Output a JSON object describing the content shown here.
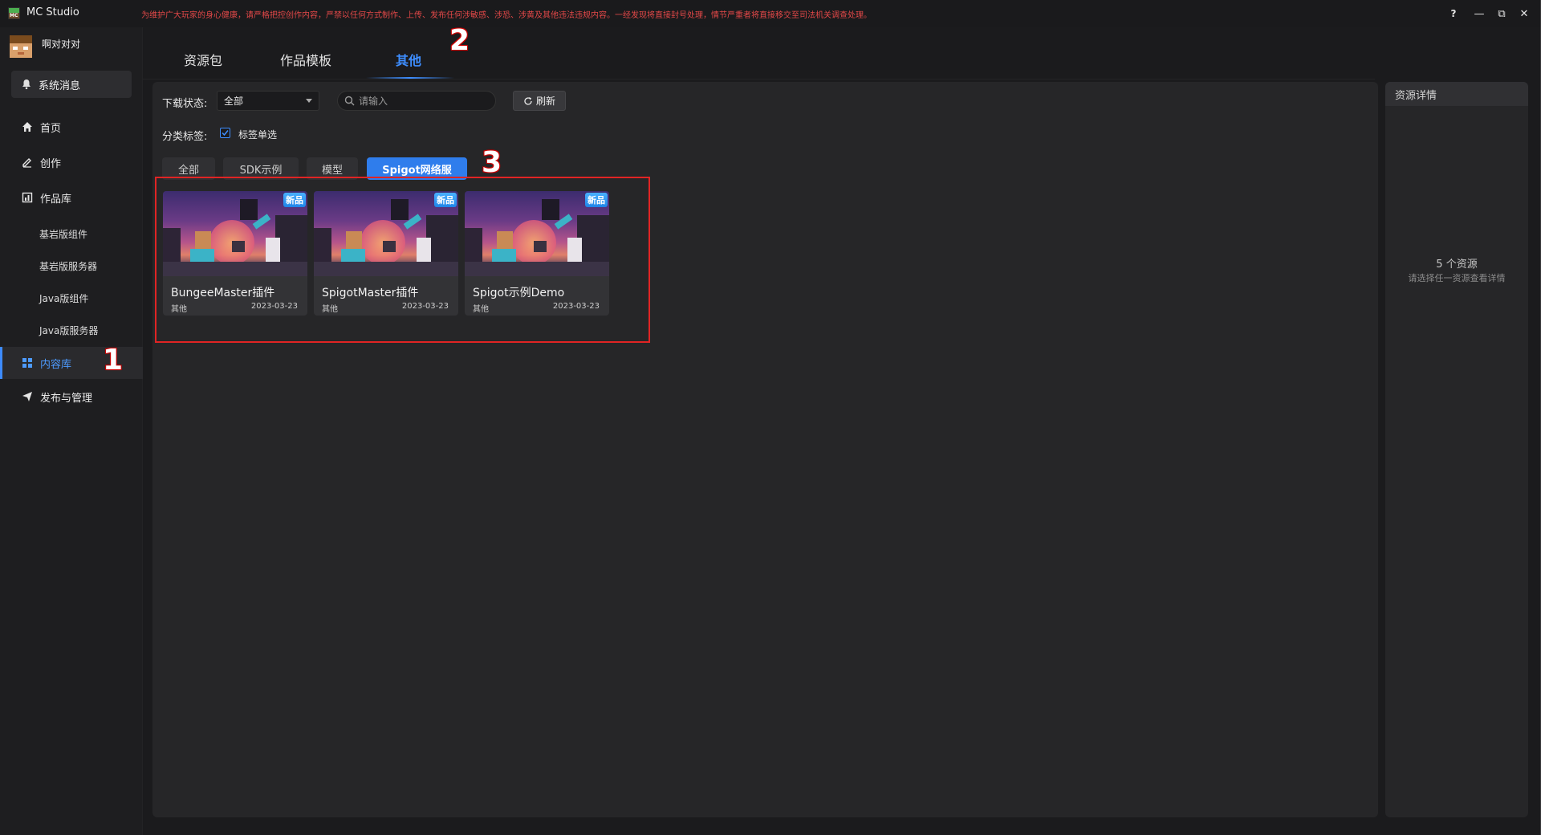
{
  "app": {
    "title": "MC Studio",
    "notice": "为维护广大玩家的身心健康，请严格把控创作内容，严禁以任何方式制作、上传、发布任何涉敏感、涉恐、涉黄及其他违法违规内容。一经发现将直接封号处理，情节严重者将直接移交至司法机关调查处理。",
    "window_controls": {
      "help": "?",
      "minimize": "—",
      "restore": "⧉",
      "close": "✕"
    }
  },
  "user": {
    "name": "啊对对对"
  },
  "sidebar": {
    "system_message": "系统消息",
    "items": [
      {
        "label": "首页",
        "icon": "home-icon"
      },
      {
        "label": "创作",
        "icon": "edit-icon"
      },
      {
        "label": "作品库",
        "icon": "library-icon"
      }
    ],
    "sub_items": [
      "基岩版组件",
      "基岩版服务器",
      "Java版组件",
      "Java版服务器"
    ],
    "active_item": {
      "label": "内容库",
      "icon": "grid-icon"
    },
    "publish_item": {
      "label": "发布与管理",
      "icon": "send-icon"
    }
  },
  "tabs": [
    "资源包",
    "作品模板",
    "其他"
  ],
  "active_tab": "其他",
  "filters": {
    "download_status_label": "下载状态:",
    "download_status_value": "全部",
    "search_placeholder": "请输入",
    "refresh_label": "刷新",
    "category_label": "分类标签:",
    "single_select_label": "标签单选",
    "single_select_checked": true
  },
  "categories": [
    "全部",
    "SDK示例",
    "模型",
    "Spigot网络服"
  ],
  "active_category": "Spigot网络服",
  "cards": [
    {
      "title": "BungeeMaster插件",
      "category": "其他",
      "date": "2023-03-23",
      "badge": "新品"
    },
    {
      "title": "SpigotMaster插件",
      "category": "其他",
      "date": "2023-03-23",
      "badge": "新品"
    },
    {
      "title": "Spigot示例Demo",
      "category": "其他",
      "date": "2023-03-23",
      "badge": "新品"
    }
  ],
  "detail": {
    "header": "资源详情",
    "count_text": "5 个资源",
    "hint_text": "请选择任一资源查看详情"
  },
  "annotations": [
    "1",
    "2",
    "3"
  ],
  "colors": {
    "accent": "#3e8eff",
    "highlight_box": "#e02424",
    "notice": "#e34848",
    "badge": "#1f85e8"
  }
}
